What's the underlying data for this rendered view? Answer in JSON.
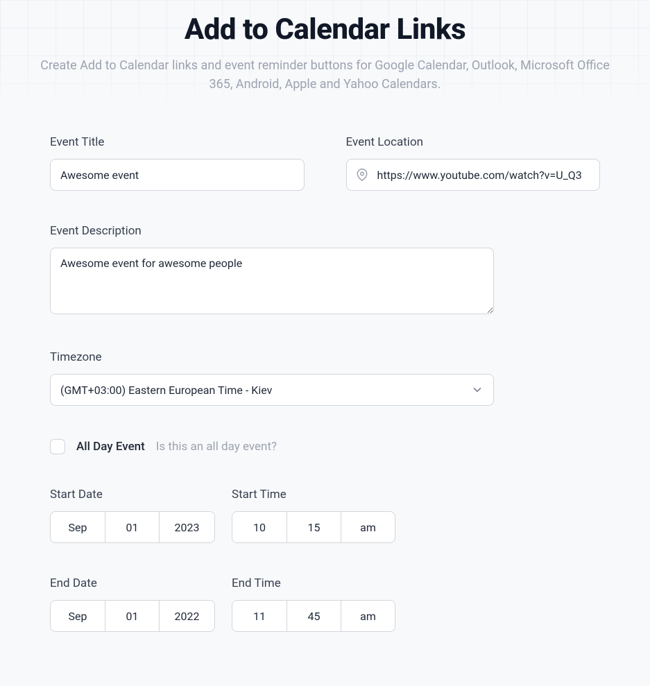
{
  "header": {
    "title": "Add to Calendar Links",
    "subtitle": "Create Add to Calendar links and event reminder buttons for Google Calendar, Outlook, Microsoft Office 365, Android, Apple and Yahoo Calendars."
  },
  "form": {
    "eventTitle": {
      "label": "Event Title",
      "value": "Awesome event"
    },
    "eventLocation": {
      "label": "Event Location",
      "value": "https://www.youtube.com/watch?v=U_Q3"
    },
    "eventDescription": {
      "label": "Event Description",
      "value": "Awesome event for awesome people"
    },
    "timezone": {
      "label": "Timezone",
      "selected": "(GMT+03:00) Eastern European Time - Kiev"
    },
    "allDay": {
      "label": "All Day Event",
      "hint": "Is this an all day event?",
      "checked": false
    },
    "startDate": {
      "label": "Start Date",
      "month": "Sep",
      "day": "01",
      "year": "2023"
    },
    "startTime": {
      "label": "Start Time",
      "hour": "10",
      "minute": "15",
      "ampm": "am"
    },
    "endDate": {
      "label": "End Date",
      "month": "Sep",
      "day": "01",
      "year": "2022"
    },
    "endTime": {
      "label": "End Time",
      "hour": "11",
      "minute": "45",
      "ampm": "am"
    }
  }
}
